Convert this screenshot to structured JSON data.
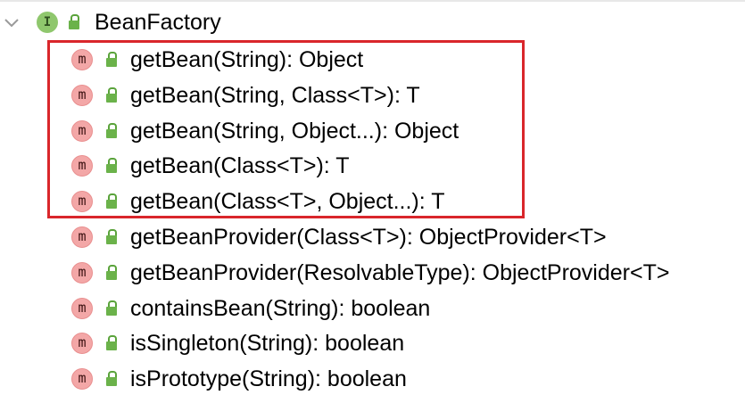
{
  "tree": {
    "root": {
      "icon_letter": "I",
      "label": "BeanFactory",
      "expanded_icon": "chevron-down-icon"
    },
    "methods": [
      {
        "icon_letter": "m",
        "label": "getBean(String): Object",
        "highlighted": true
      },
      {
        "icon_letter": "m",
        "label": "getBean(String, Class<T>): T",
        "highlighted": true
      },
      {
        "icon_letter": "m",
        "label": "getBean(String, Object...): Object",
        "highlighted": true
      },
      {
        "icon_letter": "m",
        "label": "getBean(Class<T>): T",
        "highlighted": true
      },
      {
        "icon_letter": "m",
        "label": "getBean(Class<T>, Object...): T",
        "highlighted": true
      },
      {
        "icon_letter": "m",
        "label": "getBeanProvider(Class<T>): ObjectProvider<T>",
        "highlighted": false
      },
      {
        "icon_letter": "m",
        "label": "getBeanProvider(ResolvableType): ObjectProvider<T>",
        "highlighted": false
      },
      {
        "icon_letter": "m",
        "label": "containsBean(String): boolean",
        "highlighted": false
      },
      {
        "icon_letter": "m",
        "label": "isSingleton(String): boolean",
        "highlighted": false
      },
      {
        "icon_letter": "m",
        "label": "isPrototype(String): boolean",
        "highlighted": false
      }
    ]
  },
  "colors": {
    "highlight_border": "#d9262b",
    "interface_icon": "#8fc76d",
    "method_icon": "#f3a7a7",
    "lock_icon": "#6bb24a"
  }
}
